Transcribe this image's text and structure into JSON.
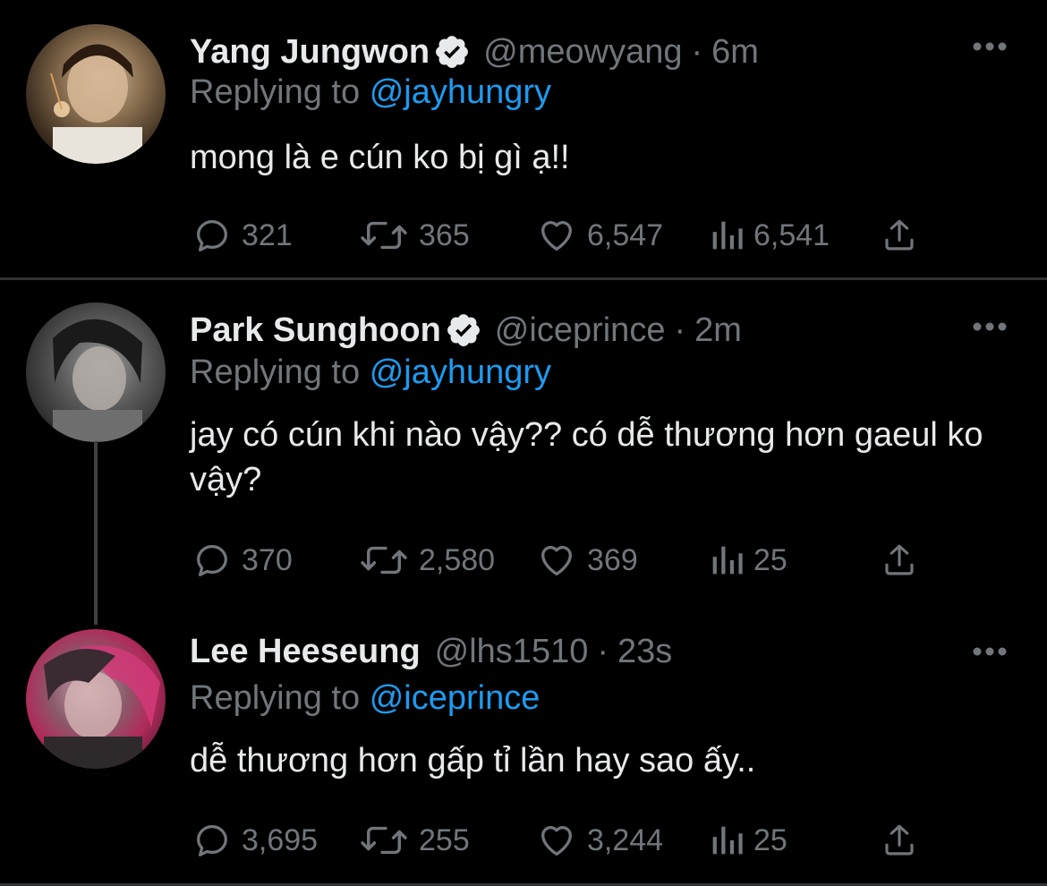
{
  "tweets": [
    {
      "display_name": "Yang Jungwon",
      "verified": true,
      "handle": "@meowyang",
      "separator": "·",
      "time": "6m",
      "reply_prefix": "Replying to",
      "reply_to": "@jayhungry",
      "text": "mong là e cún ko bị gì ạ!!",
      "replies": "321",
      "retweets": "365",
      "likes": "6,547",
      "views": "6,541"
    },
    {
      "display_name": "Park Sunghoon",
      "verified": true,
      "handle": "@iceprince",
      "separator": "·",
      "time": "2m",
      "reply_prefix": "Replying to",
      "reply_to": "@jayhungry",
      "text": "jay có cún khi nào vậy?? có dễ thương hơn gaeul ko vậy?",
      "replies": "370",
      "retweets": "2,580",
      "likes": "369",
      "views": "25"
    },
    {
      "display_name": "Lee Heeseung",
      "verified": false,
      "handle": "@lhs1510",
      "separator": "·",
      "time": "23s",
      "reply_prefix": "Replying to",
      "reply_to": "@iceprince",
      "text": "dễ thương hơn gấp tỉ lần hay sao ấy..",
      "replies": "3,695",
      "retweets": "255",
      "likes": "3,244",
      "views": "25"
    }
  ],
  "icons": {
    "more": "more-icon",
    "reply": "reply-icon",
    "retweet": "retweet-icon",
    "like": "heart-icon",
    "views": "views-icon",
    "share": "share-icon",
    "verified": "verified-badge-icon"
  },
  "colors": {
    "background": "#000000",
    "text_primary": "#e7e9ea",
    "text_secondary": "#71767b",
    "link": "#1d9bf0",
    "divider": "#2f3336"
  }
}
